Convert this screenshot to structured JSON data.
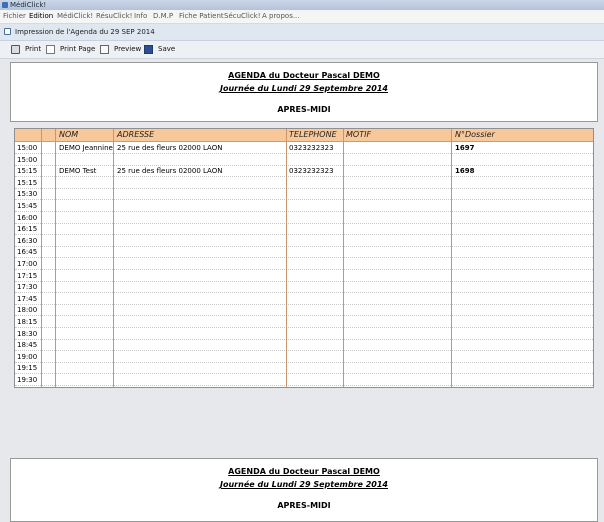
{
  "app": {
    "title": "MédiClick!"
  },
  "menu": [
    {
      "label": "Fichier"
    },
    {
      "label": "Edition"
    },
    {
      "label": "MédiClick!"
    },
    {
      "label": "RésuClick!"
    },
    {
      "label": "Info"
    },
    {
      "label": "D.M.P"
    },
    {
      "label": "Fiche Patient"
    },
    {
      "label": "SécuClick!"
    },
    {
      "label": "A propos..."
    }
  ],
  "window": {
    "subtitle": "Impression de l'Agenda du 29 SEP 2014"
  },
  "toolbar": {
    "print": "Print",
    "print_page": "Print Page",
    "preview": "Preview",
    "save": "Save"
  },
  "report": {
    "title": "AGENDA du Docteur Pascal DEMO",
    "date": "Journée du Lundi 29 Septembre 2014",
    "period": "APRES-MIDI"
  },
  "table": {
    "headers": [
      "NOM",
      "ADRESSE",
      "TELEPHONE",
      "MOTIF",
      "N°Dossier"
    ],
    "rows": [
      {
        "time": "15:00",
        "nom": "DEMO Jeannine",
        "adresse": "25 rue des fleurs  02000 LAON",
        "tel": "0323232323",
        "motif": "",
        "dossier": "1697"
      },
      {
        "time": "15:00",
        "nom": "",
        "adresse": "",
        "tel": "",
        "motif": "",
        "dossier": ""
      },
      {
        "time": "15:15",
        "nom": "DEMO Test",
        "adresse": "25 rue des fleurs  02000 LAON",
        "tel": "0323232323",
        "motif": "",
        "dossier": "1698"
      },
      {
        "time": "15:15",
        "nom": "",
        "adresse": "",
        "tel": "",
        "motif": "",
        "dossier": ""
      },
      {
        "time": "15:30",
        "nom": "",
        "adresse": "",
        "tel": "",
        "motif": "",
        "dossier": ""
      },
      {
        "time": "15:45",
        "nom": "",
        "adresse": "",
        "tel": "",
        "motif": "",
        "dossier": ""
      },
      {
        "time": "16:00",
        "nom": "",
        "adresse": "",
        "tel": "",
        "motif": "",
        "dossier": ""
      },
      {
        "time": "16:15",
        "nom": "",
        "adresse": "",
        "tel": "",
        "motif": "",
        "dossier": ""
      },
      {
        "time": "16:30",
        "nom": "",
        "adresse": "",
        "tel": "",
        "motif": "",
        "dossier": ""
      },
      {
        "time": "16:45",
        "nom": "",
        "adresse": "",
        "tel": "",
        "motif": "",
        "dossier": ""
      },
      {
        "time": "17:00",
        "nom": "",
        "adresse": "",
        "tel": "",
        "motif": "",
        "dossier": ""
      },
      {
        "time": "17:15",
        "nom": "",
        "adresse": "",
        "tel": "",
        "motif": "",
        "dossier": ""
      },
      {
        "time": "17:30",
        "nom": "",
        "adresse": "",
        "tel": "",
        "motif": "",
        "dossier": ""
      },
      {
        "time": "17:45",
        "nom": "",
        "adresse": "",
        "tel": "",
        "motif": "",
        "dossier": ""
      },
      {
        "time": "18:00",
        "nom": "",
        "adresse": "",
        "tel": "",
        "motif": "",
        "dossier": ""
      },
      {
        "time": "18:15",
        "nom": "",
        "adresse": "",
        "tel": "",
        "motif": "",
        "dossier": ""
      },
      {
        "time": "18:30",
        "nom": "",
        "adresse": "",
        "tel": "",
        "motif": "",
        "dossier": ""
      },
      {
        "time": "18:45",
        "nom": "",
        "adresse": "",
        "tel": "",
        "motif": "",
        "dossier": ""
      },
      {
        "time": "19:00",
        "nom": "",
        "adresse": "",
        "tel": "",
        "motif": "",
        "dossier": ""
      },
      {
        "time": "19:15",
        "nom": "",
        "adresse": "",
        "tel": "",
        "motif": "",
        "dossier": ""
      },
      {
        "time": "19:30",
        "nom": "",
        "adresse": "",
        "tel": "",
        "motif": "",
        "dossier": ""
      }
    ]
  },
  "footer_report": {
    "title": "AGENDA du Docteur Pascal DEMO",
    "date": "Journée du Lundi 29 Septembre 2014",
    "period": "APRES-MIDI"
  }
}
